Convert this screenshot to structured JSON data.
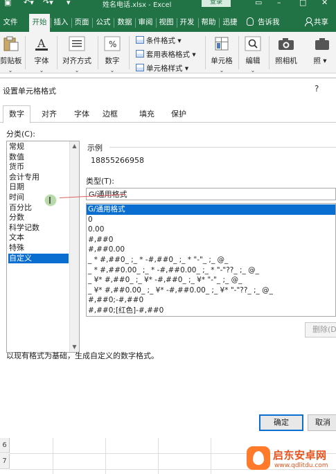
{
  "window": {
    "title": "姓名电话.xlsx - Excel",
    "login_label": "登录"
  },
  "ribbon_tabs": [
    {
      "label": "文件"
    },
    {
      "label": "开始"
    },
    {
      "label": "插入"
    },
    {
      "label": "页面"
    },
    {
      "label": "公式"
    },
    {
      "label": "数据"
    },
    {
      "label": "审阅"
    },
    {
      "label": "视图"
    },
    {
      "label": "开发"
    },
    {
      "label": "帮助"
    },
    {
      "label": "迅捷"
    }
  ],
  "tell_me": "告诉我",
  "share": "共享",
  "ribbon_groups": {
    "clipboard": "剪贴板",
    "font": "字体",
    "alignment": "对齐方式",
    "number": "数字",
    "cell": "单元格",
    "edit": "编辑",
    "camera": "照相机",
    "more": "照"
  },
  "styles": {
    "conditional": "条件格式",
    "table": "套用表格格式",
    "cell_styles": "单元格样式"
  },
  "dialog": {
    "title": "设置单元格格式",
    "help": "?",
    "tabs": [
      "数字",
      "对齐",
      "字体",
      "边框",
      "填充",
      "保护"
    ],
    "category_label": "分类(C):",
    "categories": [
      "常规",
      "数值",
      "货币",
      "会计专用",
      "日期",
      "时间",
      "百分比",
      "分数",
      "科学记数",
      "文本",
      "特殊",
      "自定义"
    ],
    "selected_category": "自定义",
    "sample_label": "示例",
    "sample_value": "18855266958",
    "type_label": "类型(T):",
    "type_value": "G/通用格式",
    "formats": [
      "G/通用格式",
      "0",
      "0.00",
      "#,##0",
      "#,##0.00",
      "_ * #,##0_ ;_ * -#,##0_ ;_ * \"-\"_ ;_ @_",
      "_ * #,##0.00_ ;_ * -#,##0.00_ ;_ * \"-\"??_ ;_ @_",
      "_ ¥* #,##0_ ;_ ¥* -#,##0_ ;_ ¥* \"-\"_ ;_ @_",
      "_ ¥* #,##0.00_ ;_ ¥* -#,##0.00_ ;_ ¥* \"-\"??_ ;_ @_",
      "#,##0;-#,##0",
      "#,##0;[红色]-#,##0"
    ],
    "delete_label": "删除(D",
    "description": "以现有格式为基础，生成自定义的数字格式。",
    "ok_label": "确定",
    "cancel_label": "取消"
  },
  "sheet": {
    "rows": [
      "6",
      "7"
    ]
  },
  "watermark": {
    "name": "启东安卓网",
    "url": "www.qdlitdu.com"
  },
  "colors": {
    "excel_green": "#217346",
    "selection_blue": "#0a6ed1"
  }
}
